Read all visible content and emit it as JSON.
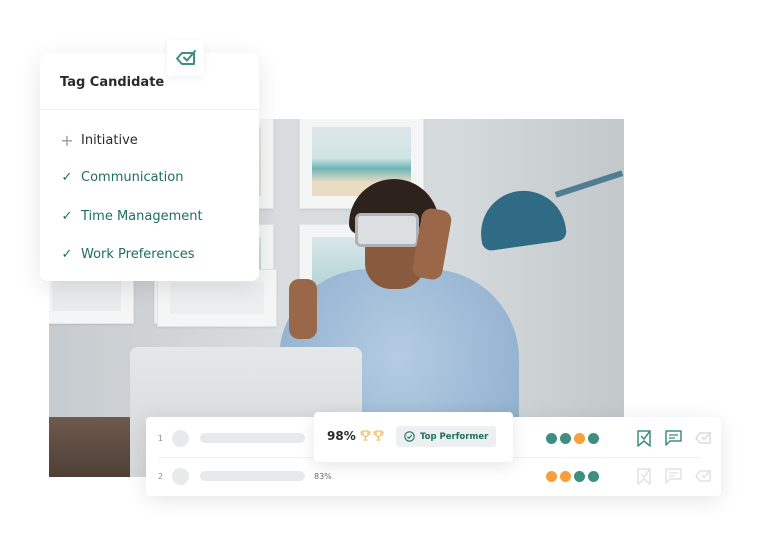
{
  "tag_card": {
    "title": "Tag Candidate",
    "header_icon": "tag-check-icon",
    "items": [
      {
        "label": "Initiative",
        "state": "add",
        "icon": "plus-icon"
      },
      {
        "label": "Communication",
        "state": "checked",
        "icon": "check-icon"
      },
      {
        "label": "Time Management",
        "state": "checked",
        "icon": "check-icon"
      },
      {
        "label": "Work Preferences",
        "state": "checked",
        "icon": "check-icon"
      }
    ],
    "icon_glyphs": {
      "add": "+",
      "checked": "✓"
    }
  },
  "candidates_table": {
    "rows": [
      {
        "rank": "1",
        "score": "98%",
        "trophies": 2,
        "badge": "Top Performer",
        "rating_dots": [
          "teal",
          "teal",
          "orange",
          "teal"
        ],
        "actions_active": true
      },
      {
        "rank": "2",
        "score": "83%",
        "rating_dots": [
          "orange",
          "orange",
          "teal",
          "teal"
        ],
        "actions_active": false
      }
    ],
    "action_icons": [
      "bookmark-check-icon",
      "comment-icon",
      "tag-check-icon"
    ]
  },
  "colors": {
    "teal": "#3d8e80",
    "orange": "#f5a03a",
    "brand_dark_teal": "#1f6e60",
    "trophy": "#f0b35a",
    "inactive_icon": "#dcdcdc"
  },
  "photo": {
    "description": "Man wearing VR headset framing with hands at a desk"
  }
}
